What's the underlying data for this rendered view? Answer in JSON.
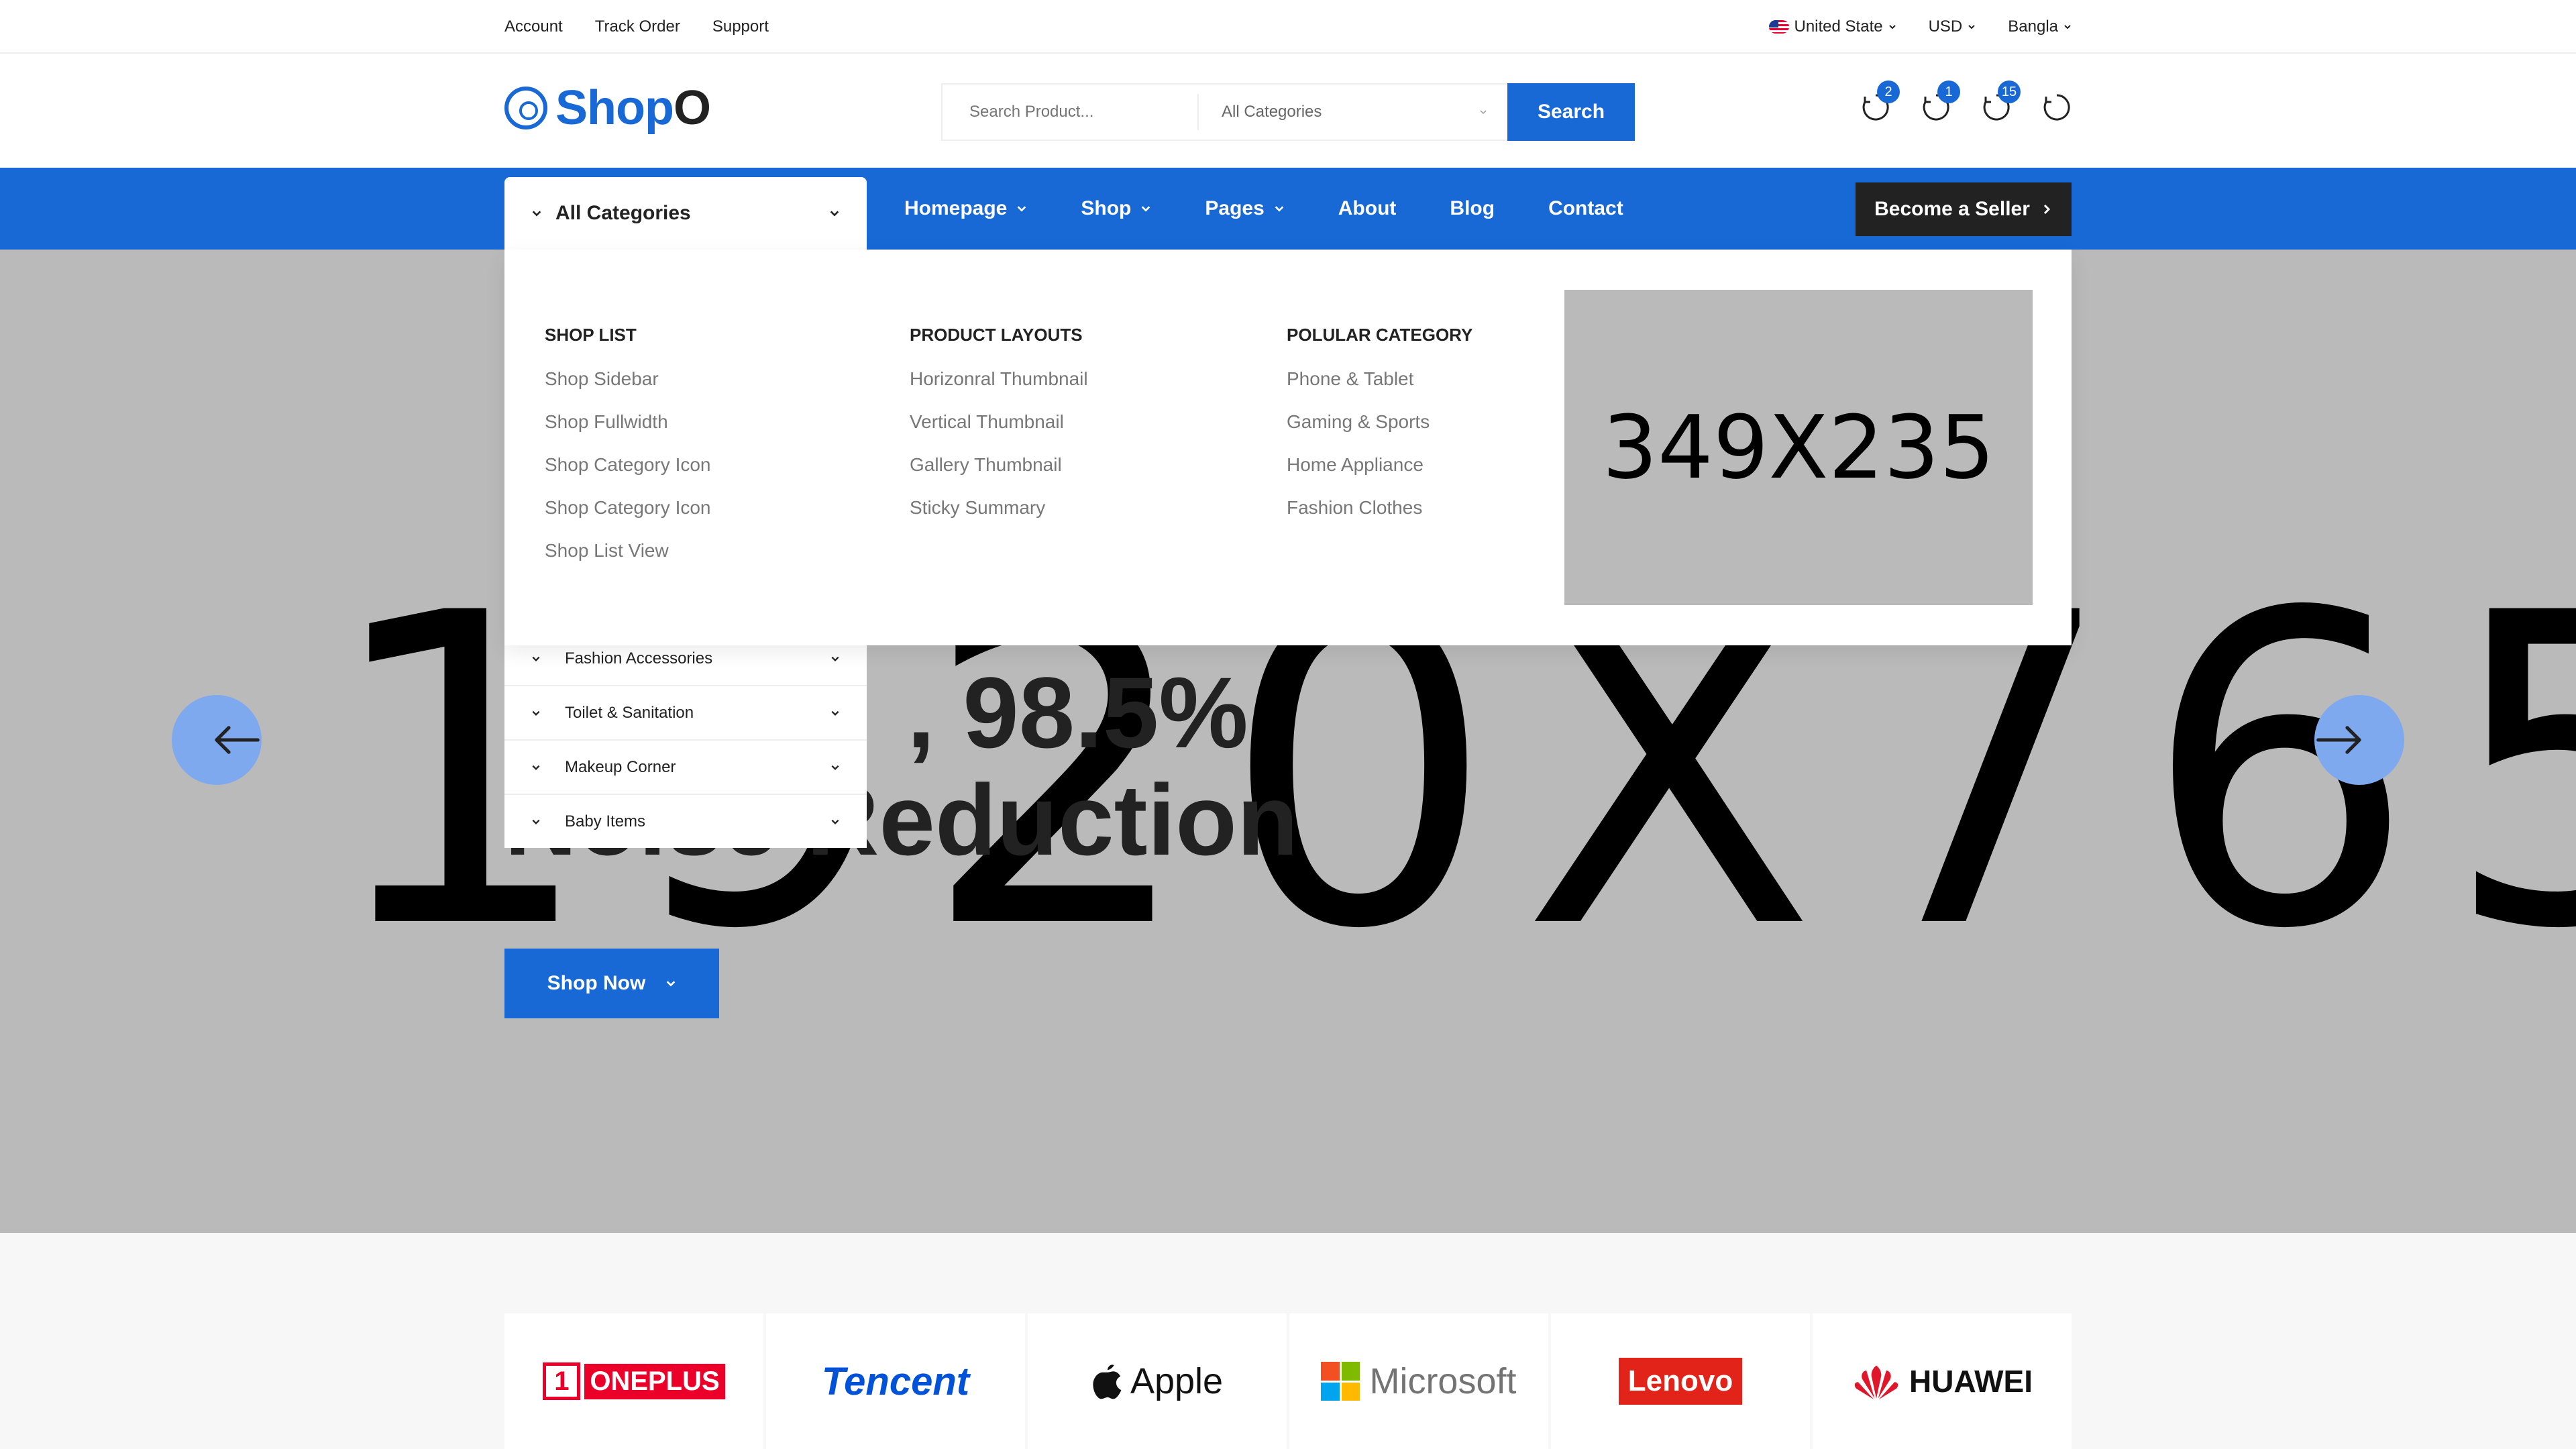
{
  "topbar": {
    "links": [
      "Account",
      "Track Order",
      "Support"
    ],
    "country": "United State",
    "currency": "USD",
    "language": "Bangla"
  },
  "header": {
    "logo_text": "Shop",
    "logo_suffix": "O",
    "search_placeholder": "Search Product...",
    "search_category": "All Categories",
    "search_button": "Search",
    "badges": [
      "2",
      "1",
      "15"
    ]
  },
  "nav": {
    "all_categories": "All Categories",
    "links": [
      "Homepage",
      "Shop",
      "Pages",
      "About",
      "Blog",
      "Contact"
    ],
    "seller_button": "Become a Seller"
  },
  "mega_menu": {
    "col1_title": "SHOP LIST",
    "col1_items": [
      "Shop Sidebar",
      "Shop Fullwidth",
      "Shop Category Icon",
      "Shop Category Icon",
      "Shop List View"
    ],
    "col2_title": "PRODUCT LAYOUTS",
    "col2_items": [
      "Horizonral Thumbnail",
      "Vertical Thumbnail",
      "Gallery Thumbnail",
      "Sticky Summary"
    ],
    "col3_title": "POLULAR CATEGORY",
    "col3_items": [
      "Phone & Tablet",
      "Gaming & Sports",
      "Home Appliance",
      "Fashion Clothes"
    ],
    "image_placeholder": "349X235"
  },
  "category_list": [
    "Fashion Accessories",
    "Toilet & Sanitation",
    "Makeup Corner",
    "Baby Items"
  ],
  "hero": {
    "placeholder": "1920X765",
    "line1": ", 98.5%",
    "line2": "Noise Reduction",
    "button": "Shop Now"
  },
  "brands": [
    "ONEPLUS",
    "Tencent",
    "Apple",
    "Microsoft",
    "Lenovo",
    "HUAWEI"
  ],
  "colors": {
    "primary": "#1868d5",
    "dark": "#222222",
    "placeholder_gray": "#bababa"
  }
}
